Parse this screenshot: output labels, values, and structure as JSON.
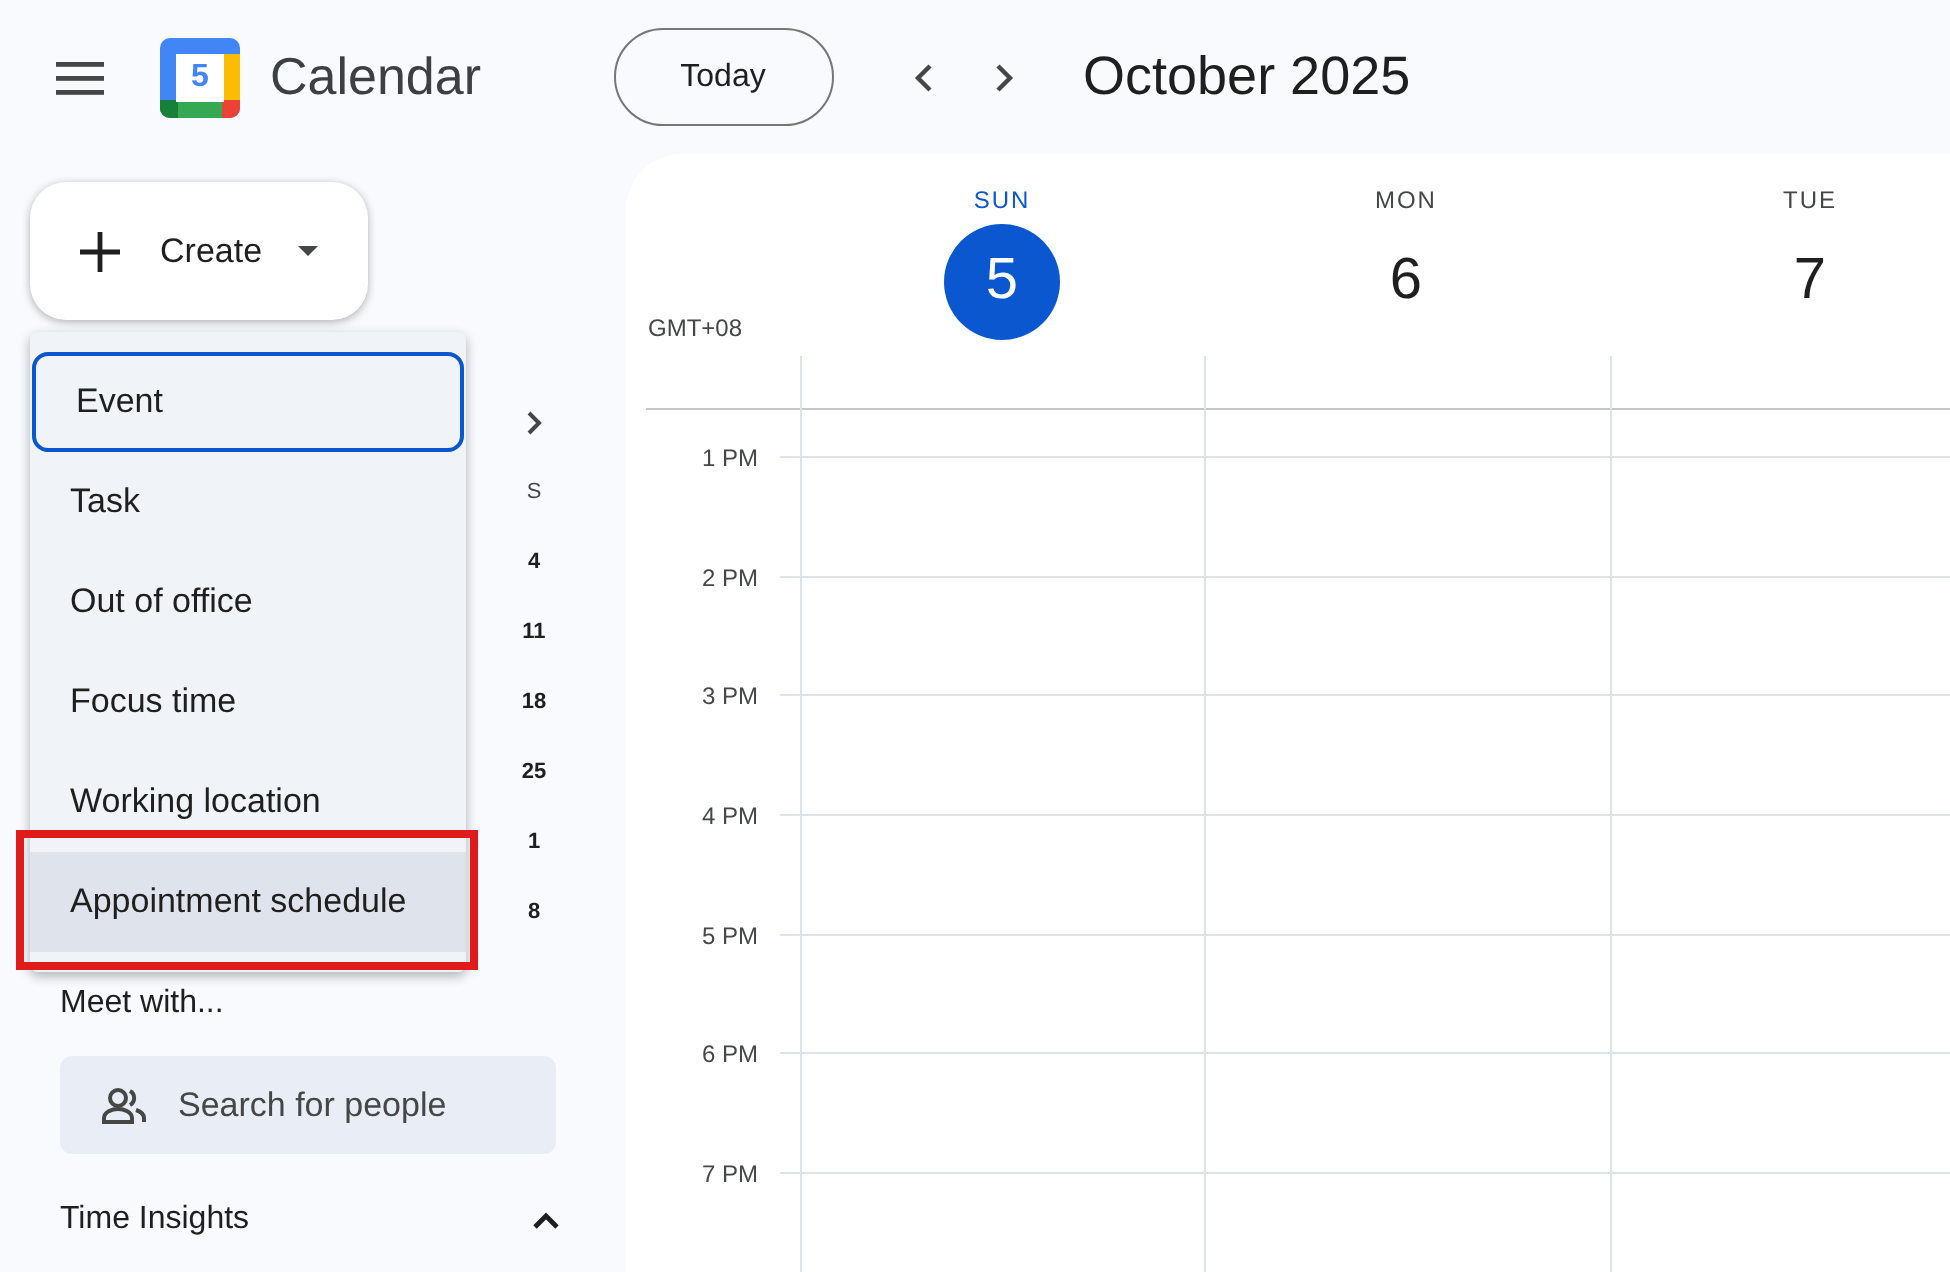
{
  "app": {
    "title": "Calendar",
    "logo_number": "5"
  },
  "toolbar": {
    "today_button": "Today",
    "period": "October 2025"
  },
  "create_button": {
    "label": "Create"
  },
  "create_menu": [
    {
      "label": "Event",
      "focused": true,
      "hovered": false,
      "annotated": false
    },
    {
      "label": "Task",
      "focused": false,
      "hovered": false,
      "annotated": false
    },
    {
      "label": "Out of office",
      "focused": false,
      "hovered": false,
      "annotated": false
    },
    {
      "label": "Focus time",
      "focused": false,
      "hovered": false,
      "annotated": false
    },
    {
      "label": "Working location",
      "focused": false,
      "hovered": false,
      "annotated": false
    },
    {
      "label": "Appointment schedule",
      "focused": false,
      "hovered": true,
      "annotated": true
    }
  ],
  "mini_calendar": {
    "weekday": "S",
    "dates": [
      "4",
      "11",
      "18",
      "25",
      "1",
      "8"
    ]
  },
  "meet_with": {
    "title": "Meet with...",
    "search": {
      "placeholder": "Search for people"
    }
  },
  "time_insights": {
    "title": "Time Insights",
    "expanded": true
  },
  "week_view": {
    "timezone": "GMT+08",
    "days": [
      {
        "weekday": "SUN",
        "date": "5",
        "selected": true
      },
      {
        "weekday": "MON",
        "date": "6",
        "selected": false
      },
      {
        "weekday": "TUE",
        "date": "7",
        "selected": false
      }
    ],
    "hours": [
      "1 PM",
      "2 PM",
      "3 PM",
      "4 PM",
      "5 PM",
      "6 PM",
      "7 PM"
    ]
  }
}
